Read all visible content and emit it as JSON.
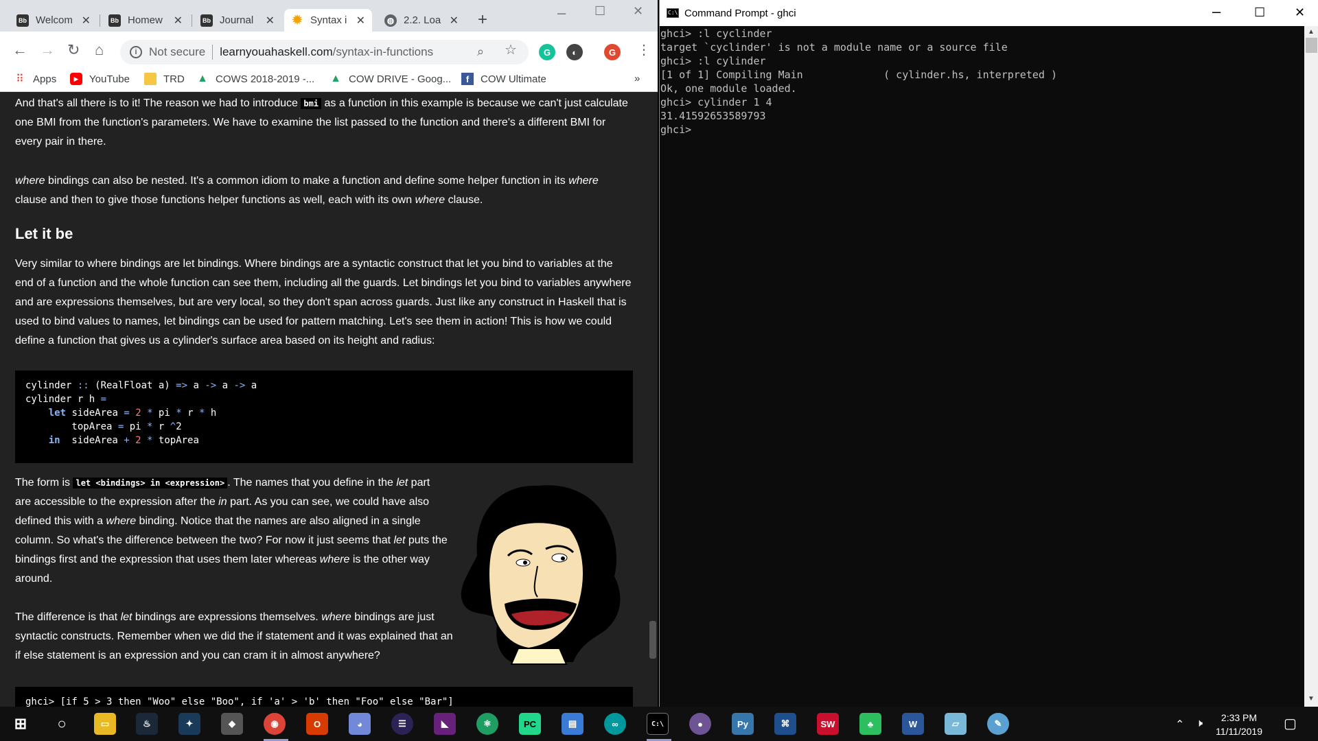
{
  "browser": {
    "tabs": [
      {
        "label": "Welcom",
        "favicon": "Bb"
      },
      {
        "label": "Homew",
        "favicon": "Bb"
      },
      {
        "label": "Journal",
        "favicon": "Bb"
      },
      {
        "label": "Syntax i",
        "favicon": "sun"
      },
      {
        "label": "2.2. Loa",
        "favicon": "globe"
      }
    ],
    "url": {
      "security": "Not secure",
      "host": "learnyouahaskell.com",
      "path": "/syntax-in-functions"
    },
    "profile_initial": "G",
    "bookmarks": [
      "Apps",
      "YouTube",
      "TRD",
      "COWS 2018-2019 -...",
      "COW DRIVE - Goog...",
      "COW Ultimate"
    ],
    "bookmarks_overflow": "»"
  },
  "page": {
    "para1": {
      "before": "And that's all there is to it! The reason we had to introduce ",
      "code": "bmi",
      "after": " as a function in this example is because we can't just calculate one BMI from the function's parameters. We have to examine the list passed to the function and there's a different BMI for every pair in there."
    },
    "para2": {
      "em1": "where",
      "t1": " bindings can also be nested. It's a common idiom to make a function and define some helper function in its ",
      "em2": "where",
      "t2": " clause and then to give those functions helper functions as well, each with its own ",
      "em3": "where",
      "t3": " clause."
    },
    "heading": "Let it be",
    "para3": "Very similar to where bindings are let bindings. Where bindings are a syntactic construct that let you bind to variables at the end of a function and the whole function can see them, including all the guards. Let bindings let you bind to variables anywhere and are expressions themselves, but are very local, so they don't span across guards. Just like any construct in Haskell that is used to bind values to names, let bindings can be used for pattern matching. Let's see them in action! This is how we could define a function that gives us a cylinder's surface area based on its height and radius:",
    "code1": [
      "cylinder :: (RealFloat a) => a -> a -> a",
      "cylinder r h =",
      "    let sideArea = 2 * pi * r * h",
      "        topArea = pi * r ^2",
      "    in  sideArea + 2 * topArea"
    ],
    "para4": {
      "t1": "The form is ",
      "code": "let <bindings> in <expression>",
      "t2": ". The names that you define in the ",
      "em1": "let",
      "t3": " part are accessible to the expression after the ",
      "em2": "in",
      "t4": " part. As you can see, we could have also defined this with a ",
      "em3": "where",
      "t5": " binding. Notice that the names are also aligned in a single column. So what's the difference between the two? For now it just seems that ",
      "em4": "let",
      "t6": " puts the bindings first and the expression that uses them later whereas ",
      "em5": "where",
      "t7": " is the other way around."
    },
    "para5": {
      "t1": "The difference is that ",
      "em1": "let",
      "t2": " bindings are expressions themselves. ",
      "em2": "where",
      "t3": " bindings are just syntactic constructs. Remember when we did the if statement and it was explained that an if else statement is an expression and you can cram it in almost anywhere?"
    },
    "code2": "ghci> [if 5 > 3 then \"Woo\" else \"Boo\", if 'a' > 'b' then \"Foo\" else \"Bar\"]"
  },
  "terminal": {
    "title": "Command Prompt - ghci",
    "lines": [
      "ghci> :l cyclinder",
      "target `cyclinder' is not a module name or a source file",
      "ghci> :l cylinder",
      "[1 of 1] Compiling Main             ( cylinder.hs, interpreted )",
      "Ok, one module loaded.",
      "ghci> cylinder 1 4",
      "31.41592653589793",
      "ghci> "
    ]
  },
  "taskbar": {
    "time": "2:33 PM",
    "date": "11/11/2019",
    "apps": [
      "file-explorer",
      "steam",
      "game-launcher",
      "game",
      "chrome",
      "office",
      "discord",
      "eclipse",
      "visual-studio",
      "atom",
      "pycharm",
      "network",
      "arduino",
      "command-prompt",
      "github-desktop",
      "python",
      "network-tool",
      "solidworks",
      "evernote",
      "word",
      "notepad",
      "paint"
    ]
  }
}
